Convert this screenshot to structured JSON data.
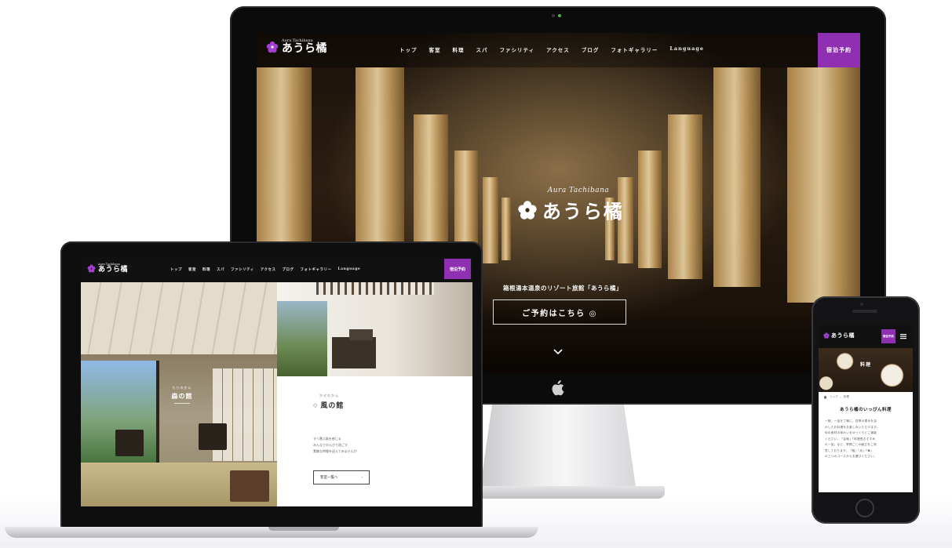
{
  "brand": {
    "name_en": "Aura Tachibana",
    "name_jp": "あうら橘"
  },
  "nav": {
    "items": [
      "トップ",
      "客室",
      "料理",
      "スパ",
      "ファシリティ",
      "アクセス",
      "ブログ",
      "フォトギャラリー",
      "Language"
    ],
    "reserve": "宿泊予約"
  },
  "hero": {
    "tagline": "箱根湯本温泉のリゾート旅館「あうら橘」",
    "cta": "ご予約はこちら ◎"
  },
  "laptop": {
    "room_left": {
      "label_sub": "もりのかん",
      "label": "森の館"
    },
    "room_right": {
      "label_sub": "かぜのかん",
      "title": "風の館",
      "desc_lines": [
        "すべ運ぶ風を感じる",
        "みんなでのんびり過ごす",
        "素敵な時間を迎えてみませんか"
      ],
      "button": "客室一覧へ",
      "button_arrow": "›"
    }
  },
  "phone": {
    "reserve": "宿泊予約",
    "hero_label": "料理",
    "breadcrumb": [
      "トップ",
      "›",
      "料理"
    ],
    "heading": "あうら橘のいっぴん料理",
    "body_lines": [
      "一椀、一品を丁寧に。四季の恵みを活",
      "かしたお料理をお楽しみいただけます。",
      "旬の食材の味わいをゆっくりとご堪能",
      "ください。「会席」「料理長おすすめ",
      "の一品」など、季節ごとの献立をご用",
      "意しております。「雅」「月」「華」",
      "の三つのコースからお選びください。"
    ]
  },
  "colors": {
    "accent": "#8f2fb1",
    "nav_bg": "#111111",
    "device_black": "#0b0b0c"
  },
  "icons": [
    "flower-logo-icon",
    "apple-logo-icon",
    "chevron-down-icon",
    "menu-icon",
    "home-icon"
  ]
}
